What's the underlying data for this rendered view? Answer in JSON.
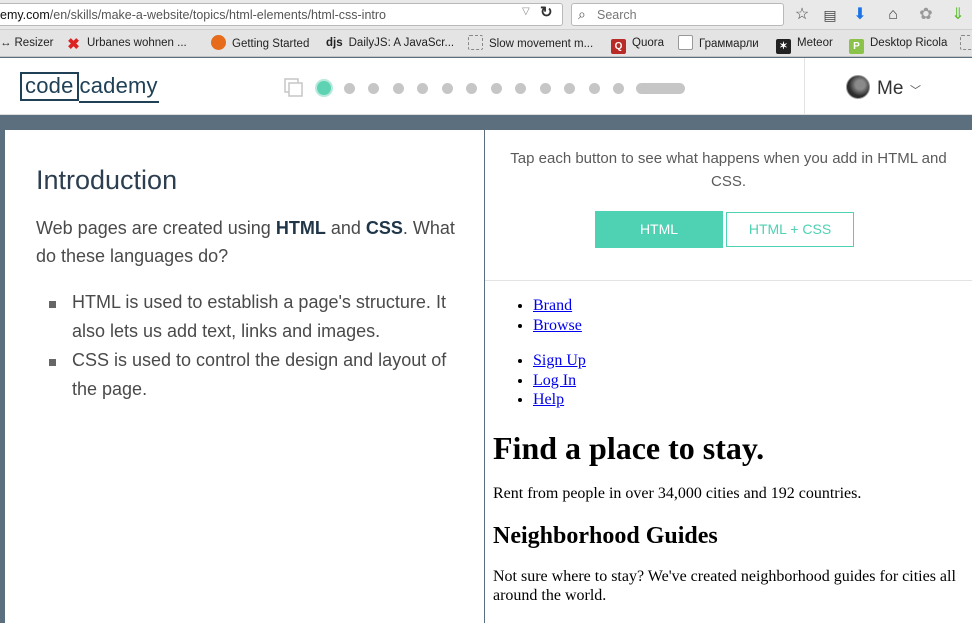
{
  "browser": {
    "url_host": "emy.com",
    "url_path": "/en/skills/make-a-website/topics/html-elements/html-css-intro",
    "search_placeholder": "Search",
    "bookmarks": [
      {
        "label": "Resizer",
        "icon": "arrows-icon"
      },
      {
        "label": "Urbanes wohnen ...",
        "icon": "x-logo-icon"
      },
      {
        "label": "Getting Started",
        "icon": "firefox-icon"
      },
      {
        "label": "DailyJS: A JavaScr...",
        "icon": "djs-icon",
        "prefix": "djs"
      },
      {
        "label": "Slow movement m...",
        "icon": "page-icon"
      },
      {
        "label": "Quora",
        "icon": "quora-icon",
        "prefix": "Q"
      },
      {
        "label": "Граммарли",
        "icon": "grammarly-icon"
      },
      {
        "label": "Meteor",
        "icon": "meteor-icon"
      },
      {
        "label": "Desktop Ricola",
        "icon": "ricola-icon",
        "prefix": "P"
      }
    ]
  },
  "header": {
    "logo_boxed": "code",
    "logo_rest": "cademy",
    "user_label": "Me"
  },
  "lesson": {
    "title": "Introduction",
    "intro_pre": "Web pages are created using ",
    "intro_b1": "HTML",
    "intro_mid": " and ",
    "intro_b2": "CSS",
    "intro_post": ". What do these languages do?",
    "bullets": [
      "HTML is used to establish a page's structure. It also lets us add text, links and images.",
      "CSS is used to control the design and layout of the page."
    ]
  },
  "demo": {
    "instruction": "Tap each button to see what happens when you add in HTML and CSS.",
    "btn_html": "HTML",
    "btn_html_css": "HTML + CSS",
    "preview": {
      "nav1": [
        "Brand",
        "Browse"
      ],
      "nav2": [
        "Sign Up",
        "Log In",
        "Help"
      ],
      "heading": "Find a place to stay.",
      "sub": "Rent from people in over 34,000 cities and 192 countries.",
      "h2": "Neighborhood Guides",
      "h2_text": "Not sure where to stay? We've created neighborhood guides for cities all around the world."
    }
  }
}
